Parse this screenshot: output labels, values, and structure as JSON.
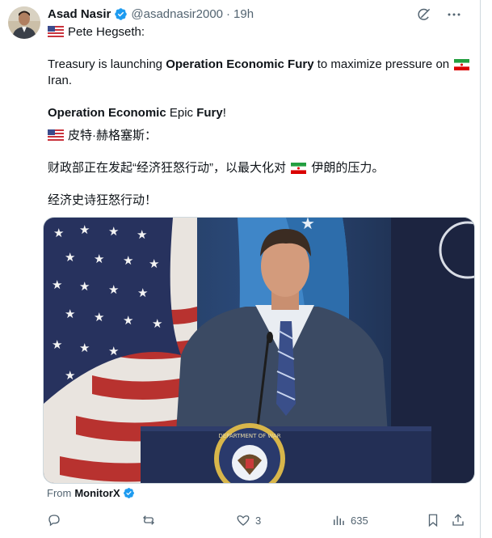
{
  "post": {
    "author_name": "Asad Nasir",
    "handle": "@asadnasir2000",
    "separator": "·",
    "time": "19h",
    "line_speaker_en": "Pete Hegseth:",
    "line_body_en_1a": "Treasury is launching ",
    "line_body_en_1b": "Operation Economic Fury",
    "line_body_en_1c": " to maximize pressure on",
    "line_body_en_2": "Iran.",
    "line_epic_a": "Operation Economic",
    "line_epic_b": " Epic ",
    "line_epic_c": "Fury",
    "line_epic_d": "!",
    "line_speaker_zh": "皮特·赫格塞斯：",
    "line_body_zh_a": "财政部正在发起“经济狂怒行动”，以最大化对",
    "line_body_zh_b": "伊朗的压力。",
    "line_epic_zh": "经济史诗狂怒行动！"
  },
  "media": {
    "podium_seal_text": "DEPARTMENT OF WAR"
  },
  "source": {
    "from_label": "From",
    "name": "MonitorX"
  },
  "actions": {
    "likes": "3",
    "views": "635"
  },
  "icons": [
    "verified-icon",
    "grok-icon",
    "more-icon",
    "reply-icon",
    "repost-icon",
    "like-icon",
    "views-icon",
    "bookmark-icon",
    "share-icon",
    "us-flag-icon",
    "iran-flag-icon"
  ],
  "colors": {
    "verified": "#1d9bf0",
    "muted": "#536471",
    "text": "#0f1419"
  }
}
